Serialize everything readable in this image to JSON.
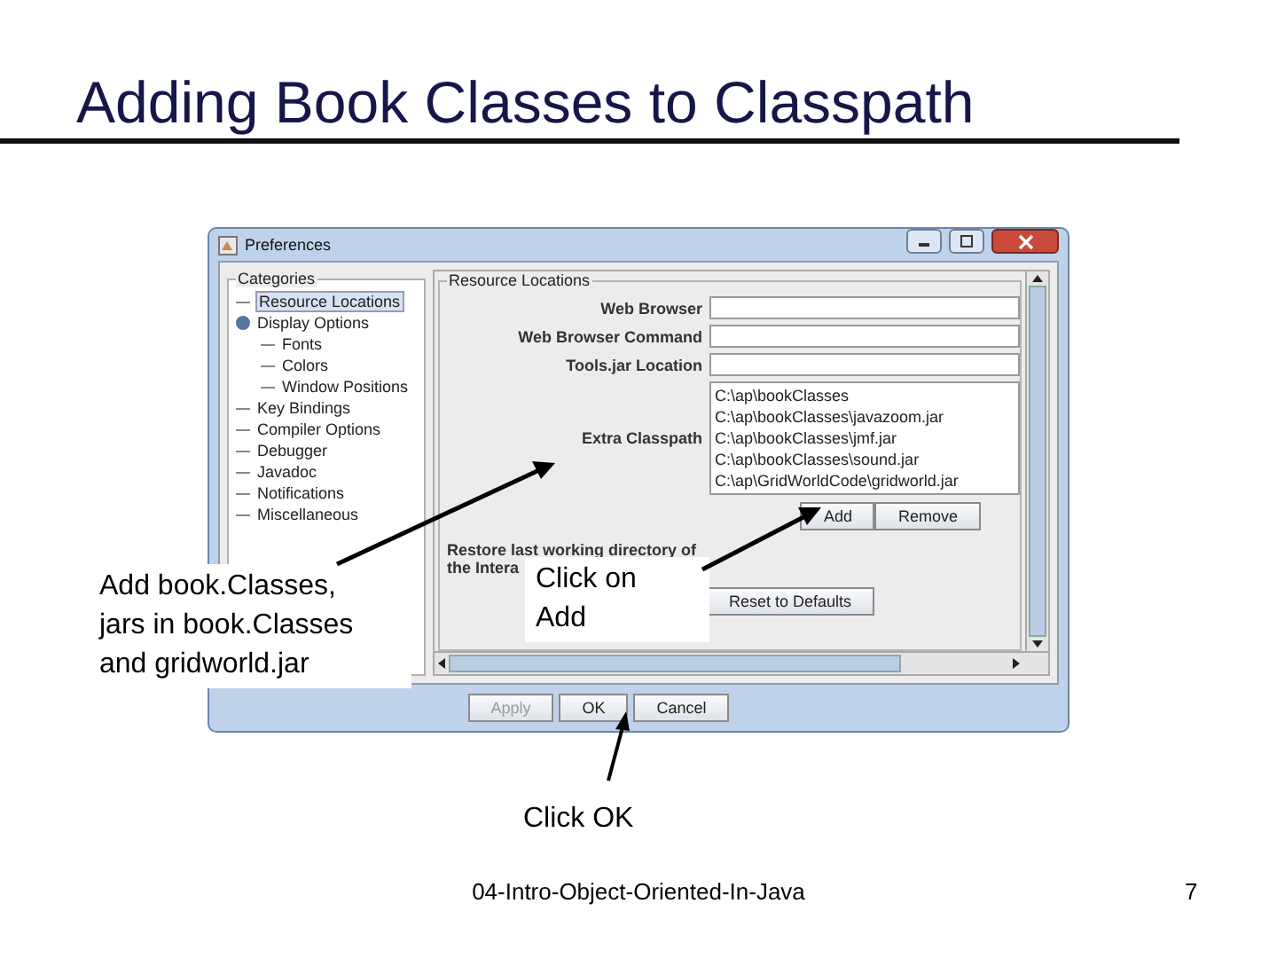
{
  "slide": {
    "title": "Adding Book Classes to Classpath",
    "footer": "04-Intro-Object-Oriented-In-Java",
    "page_number": "7"
  },
  "window": {
    "title": "Preferences"
  },
  "categories": {
    "legend": "Categories",
    "items": [
      {
        "label": "Resource Locations",
        "selected": true
      },
      {
        "label": "Display Options",
        "selected": false,
        "expanded": true,
        "children": [
          {
            "label": "Fonts",
            "selected": false
          },
          {
            "label": "Colors",
            "selected": false
          },
          {
            "label": "Window Positions",
            "selected": false
          }
        ]
      },
      {
        "label": "Key Bindings",
        "selected": false
      },
      {
        "label": "Compiler Options",
        "selected": false
      },
      {
        "label": "Debugger",
        "selected": false
      },
      {
        "label": "Javadoc",
        "selected": false
      },
      {
        "label": "Notifications",
        "selected": false
      },
      {
        "label": "Miscellaneous",
        "selected": false
      }
    ]
  },
  "resource_locations": {
    "legend": "Resource Locations",
    "fields": [
      {
        "label": "Web Browser"
      },
      {
        "label": "Web Browser Command"
      },
      {
        "label": "Tools.jar Location"
      }
    ],
    "classpath": {
      "label": "Extra Classpath",
      "entries": [
        "C:\\ap\\bookClasses",
        "C:\\ap\\bookClasses\\javazoom.jar",
        "C:\\ap\\bookClasses\\jmf.jar",
        "C:\\ap\\bookClasses\\sound.jar",
        "C:\\ap\\GridWorldCode\\gridworld.jar"
      ]
    },
    "list_buttons": [
      "Add",
      "Remove"
    ],
    "restore_label": "Restore last working directory of",
    "restore_label_cut": "the Intera",
    "reset_button": "Reset to Defaults"
  },
  "buttons": [
    {
      "label": "Apply",
      "disabled": true
    },
    {
      "label": "OK",
      "disabled": false
    },
    {
      "label": "Cancel",
      "disabled": false
    }
  ],
  "callouts": [
    {
      "lines": [
        "Add book.Classes,",
        "jars in book.Classes",
        "and gridworld.jar"
      ]
    },
    {
      "lines": [
        "Click on",
        "Add"
      ]
    },
    {
      "lines": [
        "Click OK"
      ]
    }
  ]
}
